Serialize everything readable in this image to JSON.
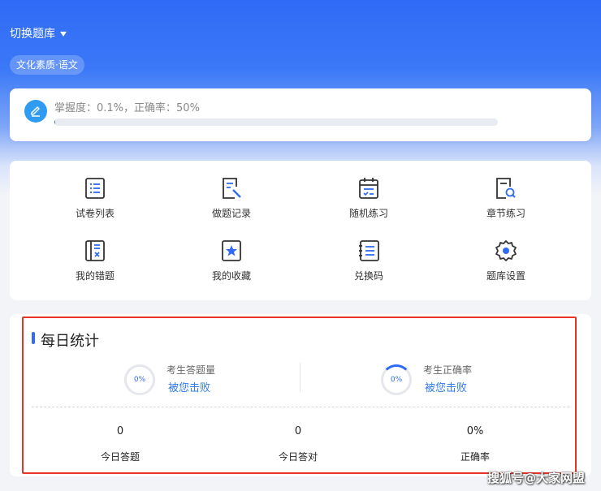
{
  "header": {
    "switch_label": "切换题库",
    "subject": "文化素质·语文"
  },
  "mastery": {
    "text": "掌握度：0.1%，正确率：50%",
    "progress": 0.001
  },
  "menu": {
    "items": [
      {
        "label": "试卷列表",
        "icon": "list-icon"
      },
      {
        "label": "做题记录",
        "icon": "record-edit-icon"
      },
      {
        "label": "随机练习",
        "icon": "calendar-check-icon"
      },
      {
        "label": "章节练习",
        "icon": "doc-search-icon"
      },
      {
        "label": "我的错题",
        "icon": "wrong-book-icon"
      },
      {
        "label": "我的收藏",
        "icon": "star-box-icon"
      },
      {
        "label": "兑换码",
        "icon": "redeem-list-icon"
      },
      {
        "label": "题库设置",
        "icon": "gear-icon"
      }
    ]
  },
  "daily": {
    "title": "每日统计",
    "stats": [
      {
        "ring": "0%",
        "label": "考生答题量",
        "link": "被您击败"
      },
      {
        "ring": "0%",
        "label": "考生正确率",
        "link": "被您击败"
      }
    ],
    "summary": [
      {
        "value": "0",
        "label": "今日答题"
      },
      {
        "value": "0",
        "label": "今日答对"
      },
      {
        "value": "0%",
        "label": "正确率"
      }
    ]
  },
  "watermark": "搜狐号@大家网盟",
  "colors": {
    "accent": "#2f6bf6",
    "highlight": "#e8332a",
    "link": "#2f7bf0"
  }
}
